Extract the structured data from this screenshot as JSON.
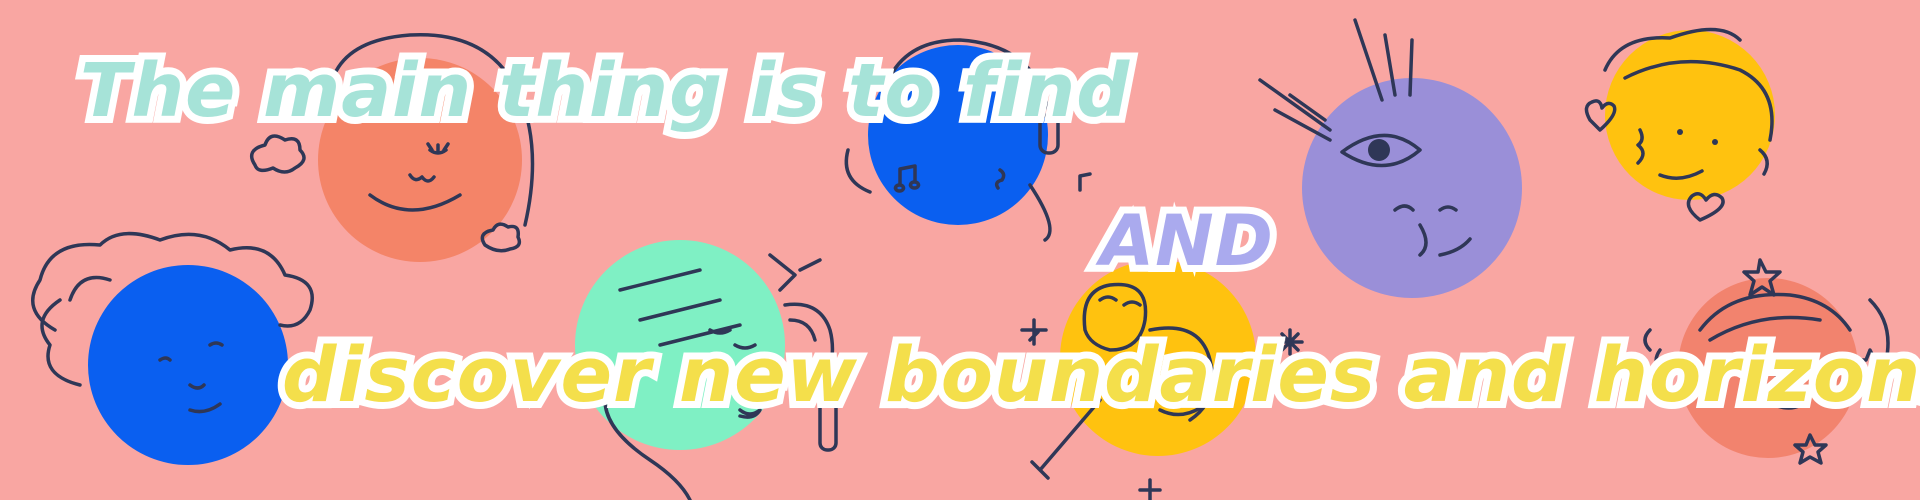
{
  "banner": {
    "line1": "The main thing is to find",
    "line2": "AND",
    "line3": "discover new boundaries and horizons"
  },
  "colors": {
    "background": "#f9a6a2",
    "line1": "#a6e3d8",
    "line2": "#aaaaee",
    "line3": "#f4df4b",
    "outline": "#ffffff",
    "ink": "#2f3757",
    "coral": "#f48468",
    "blue": "#0a5ff0",
    "mint": "#7ff0c4",
    "yellow": "#ffc20f",
    "lavender": "#9a8fd8",
    "salmon": "#f2836e"
  },
  "illustrations": [
    "coral-sleeping-face",
    "blue-headphones-face",
    "lavender-eye-face",
    "yellow-heart-face",
    "blue-cloud-hair-face",
    "mint-headphones-face",
    "yellow-microphone-face",
    "coral-stars-face"
  ]
}
